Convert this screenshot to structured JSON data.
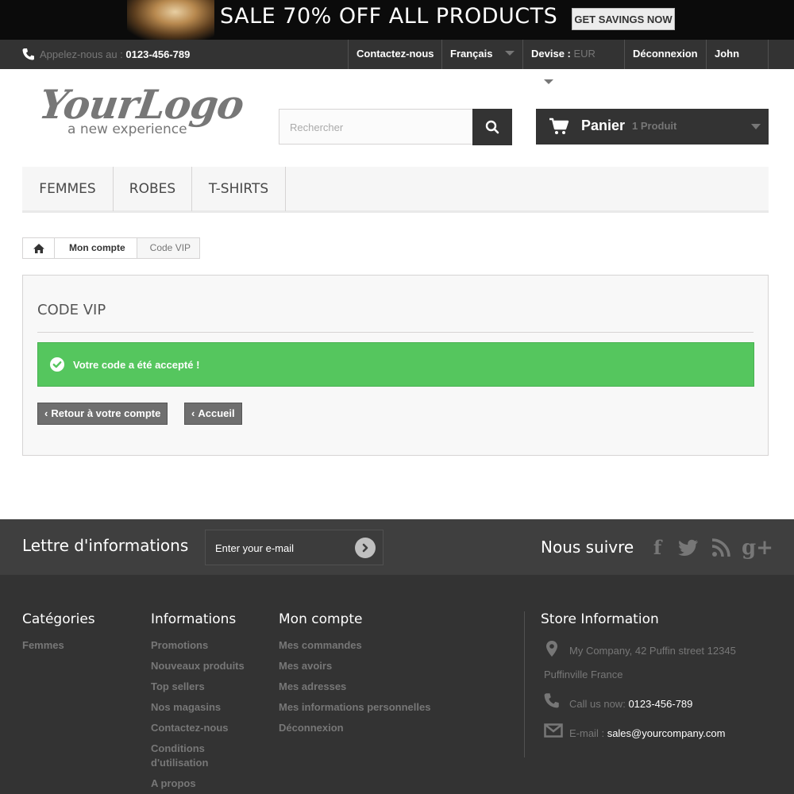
{
  "banner": {
    "text": "SALE 70% OFF ALL PRODUCTS",
    "button": "GET SAVINGS NOW"
  },
  "nav": {
    "phone_prefix": "Appelez-nous au : ",
    "phone": "0123-456-789",
    "contact": "Contactez-nous",
    "language": "Français",
    "currency_label": "Devise :",
    "currency_value": "EUR",
    "logout": "Déconnexion",
    "user": "John Doe"
  },
  "logo": {
    "main": "YourLogo",
    "tagline": "a new experience"
  },
  "search": {
    "placeholder": "Rechercher"
  },
  "cart": {
    "label": "Panier",
    "count": "1 Produit"
  },
  "menu": {
    "items": [
      "FEMMES",
      "ROBES",
      "T-SHIRTS"
    ]
  },
  "breadcrumb": {
    "account": "Mon compte",
    "current": "Code VIP"
  },
  "content": {
    "title": "CODE VIP",
    "alert": "Votre code a été accepté !",
    "back_account": "Retour à votre compte",
    "home": "Accueil"
  },
  "newsletter": {
    "title": "Lettre d'informations",
    "placeholder": "Enter your e-mail",
    "follow": "Nous suivre"
  },
  "footer": {
    "categories": {
      "title": "Catégories",
      "links": [
        "Femmes"
      ]
    },
    "informations": {
      "title": "Informations",
      "links": [
        "Promotions",
        "Nouveaux produits",
        "Top sellers",
        "Nos magasins",
        "Contactez-nous",
        "Conditions d'utilisation",
        "A propos"
      ]
    },
    "account": {
      "title": "Mon compte",
      "links": [
        "Mes commandes",
        "Mes avoirs",
        "Mes adresses",
        "Mes informations personnelles",
        "Déconnexion"
      ]
    },
    "store": {
      "title": "Store Information",
      "address": "My Company, 42 Puffin street 12345",
      "address2": "Puffinville France",
      "call_label": "Call us now:",
      "call_number": "0123-456-789",
      "email_label": "E-mail :",
      "email": "sales@yourcompany.com"
    }
  }
}
